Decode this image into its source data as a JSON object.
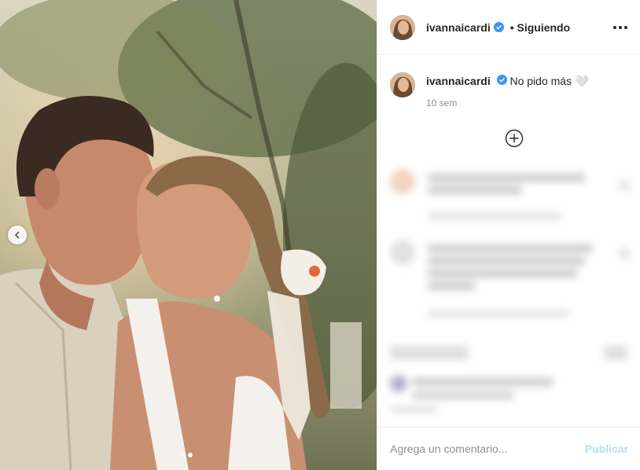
{
  "post": {
    "username": "ivannaicardi",
    "follow_status": "• Siguiendo",
    "caption_text": "No pido más",
    "caption_emoji": "🤍",
    "time_ago": "10 sem"
  },
  "comment_box": {
    "placeholder": "Agrega un comentario...",
    "publish_label": "Publicar"
  },
  "carousel": {
    "slides": 2,
    "current": 2
  },
  "colors": {
    "verified": "#3897f0",
    "publish_disabled": "#b2dffc"
  }
}
